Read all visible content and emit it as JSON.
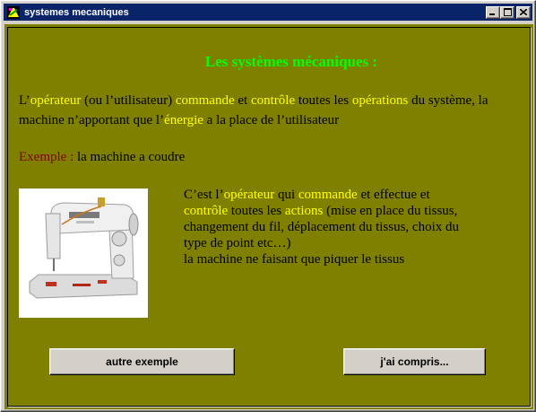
{
  "window": {
    "title": "systemes mecaniques",
    "controls": {
      "minimize": "_",
      "maximize": "□",
      "close": "×"
    }
  },
  "content": {
    "heading": "Les systèmes mécaniques :",
    "intro": {
      "p1": "L’",
      "h1": "opérateur",
      "p2": " (ou l’utilisateur) ",
      "h2": "commande",
      "p3": " et ",
      "h3": "contrôle",
      "p4": " toutes les ",
      "h4": "opérations",
      "p5": " du système, la machine n’apportant que l’",
      "h5": "énergie",
      "p6": " a la place de l’utilisateur"
    },
    "example": {
      "label": "Exemple : ",
      "text": "la machine a coudre"
    },
    "image": {
      "name": "sewing-machine-photo"
    },
    "description": {
      "p1": "C’est l’",
      "h1": "opérateur",
      "p2": " qui ",
      "h2": "commande",
      "p3": " et effectue et ",
      "h3": "contrôle",
      "p4": " toutes les ",
      "h4": "actions",
      "p5": " (mise en place du tissus, changement du fil, déplacement du tissus, choix du type de point etc…)",
      "p6": "la machine ne faisant que piquer le tissus"
    }
  },
  "buttons": {
    "other_example": "autre exemple",
    "understood": "j'ai compris..."
  },
  "colors": {
    "background": "#808000",
    "heading": "#00ff00",
    "highlight": "#ffff00",
    "example_label": "#800000",
    "titlebar": "#0a246a"
  }
}
